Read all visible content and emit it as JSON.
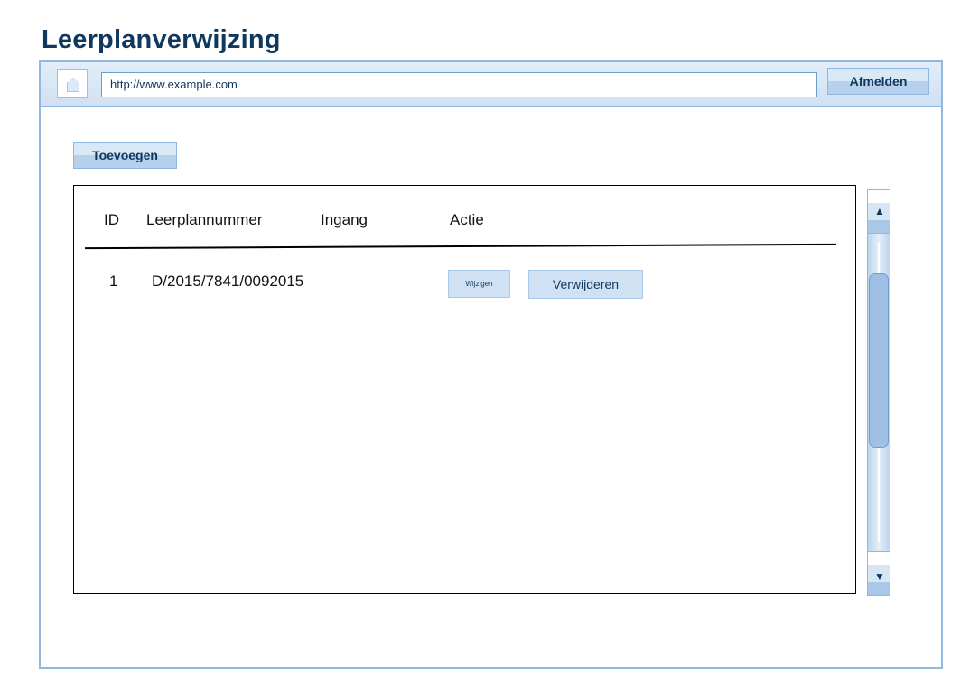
{
  "page": {
    "title": "Leerplanverwijzing"
  },
  "browser": {
    "url": "http://www.example.com",
    "logout_label": "Afmelden",
    "icons": {
      "home": "home-icon",
      "scroll_up": "arrow-up-icon",
      "scroll_down": "arrow-down-icon"
    }
  },
  "toolbar": {
    "add_label": "Toevoegen"
  },
  "table": {
    "columns": [
      "ID",
      "Leerplannummer",
      "Ingang",
      "Actie"
    ],
    "rows": [
      {
        "id": "1",
        "leerplannummer": "D/2015/7841/0092015",
        "ingang": "",
        "edit_label": "Wijzigen",
        "delete_label": "Verwijderen"
      }
    ]
  },
  "colors": {
    "title": "#10385f",
    "accent": "#90b8e0",
    "button_fill": "#cfe1f3"
  }
}
